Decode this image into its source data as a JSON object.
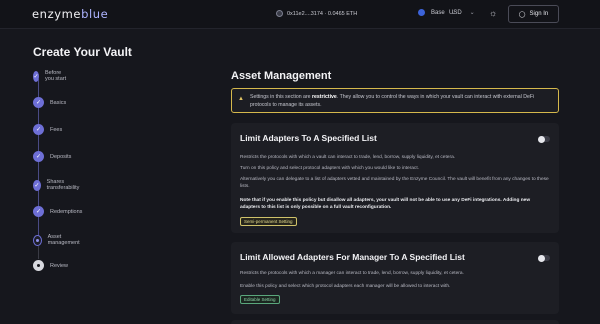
{
  "topbar": {
    "logo_main": "enzyme",
    "logo_accent": "blue",
    "wallet": "0x11e2....3174 · 0.0465 ETH",
    "network": "Base",
    "currency": "USD",
    "signin_label": "Sign In"
  },
  "page_title": "Create Your Vault",
  "steps": [
    {
      "label": "Before you start",
      "state": "done"
    },
    {
      "label": "Basics",
      "state": "done"
    },
    {
      "label": "Fees",
      "state": "done"
    },
    {
      "label": "Deposits",
      "state": "done"
    },
    {
      "label": "Shares transferability",
      "state": "done"
    },
    {
      "label": "Redemptions",
      "state": "done"
    },
    {
      "label": "Asset management",
      "state": "active"
    },
    {
      "label": "Review",
      "state": "pending"
    }
  ],
  "main": {
    "section_title": "Asset Management",
    "warning": {
      "prefix": "Settings in this section are ",
      "emphasis": "restrictive",
      "suffix": ". They allow you to control the ways in which your vault can interact with external DeFi protocols to manage its assets."
    },
    "cards": [
      {
        "title": "Limit Adapters To A Specified List",
        "paragraphs": [
          "Restricts the protocols with which a vault can interact to trade, lend, borrow, supply liquidity, et cetera.",
          "Turn on this policy and select protocol adapters with which you would like to interact.",
          "Alternatively you can delegate to a list of adapters vetted and maintained by the Enzyme Council. The vault will benefit from any changes to these lists."
        ],
        "note": "Note that if you enable this policy but disallow all adapters, your vault will not be able to use any DeFi integrations. Adding new adapters to this list is only possible on a full vault reconfiguration.",
        "badge": "Semi-permanent Setting"
      },
      {
        "title": "Limit Allowed Adapters For Manager To A Specified List",
        "paragraphs": [
          "Restricts the protocols with which a manager can interact to trade, lend, borrow, supply liquidity, et cetera.",
          "Enable this policy and select which protocol adapters each manager will be allowed to interact with."
        ],
        "badge": "Editable Setting"
      }
    ]
  }
}
